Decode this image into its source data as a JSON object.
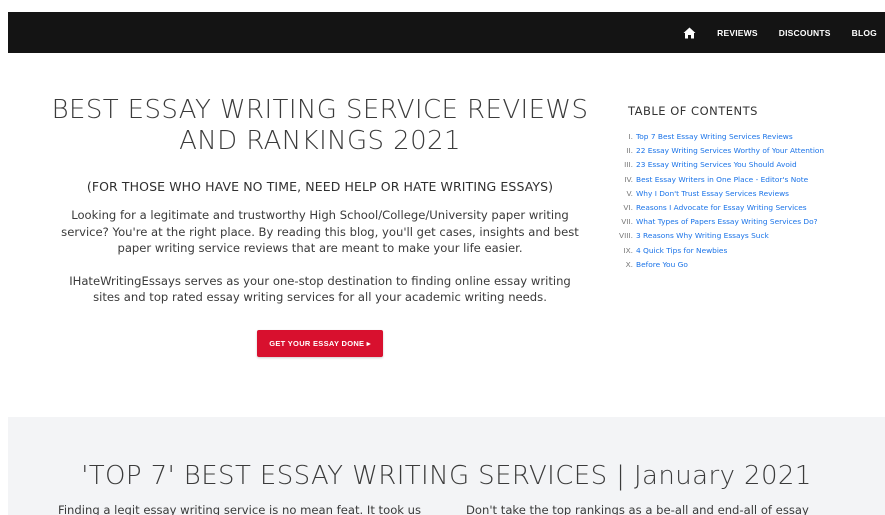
{
  "nav": {
    "home_icon": "home-icon",
    "items": [
      {
        "label": "REVIEWS"
      },
      {
        "label": "DISCOUNTS"
      },
      {
        "label": "BLOG"
      }
    ]
  },
  "hero": {
    "title": "BEST ESSAY WRITING SERVICE REVIEWS AND RANKINGS 2021",
    "subtitle": "(FOR THOSE WHO HAVE NO TIME, NEED HELP OR HATE WRITING ESSAYS)",
    "paragraph1": "Looking for a legitimate and trustworthy High School/College/University paper writing service? You're at the right place. By reading this blog, you'll get cases, insights and best paper writing service reviews that are meant to make your life easier.",
    "paragraph2": "IHateWritingEssays serves as your one-stop destination to finding online essay writing sites and top rated essay writing services for all your academic writing needs.",
    "cta_label": "GET YOUR ESSAY DONE ▸",
    "cta_color": "#d8102e"
  },
  "toc": {
    "title": "TABLE OF CONTENTS",
    "items": [
      {
        "num": "I.",
        "label": "Top 7 Best Essay Writing Services Reviews"
      },
      {
        "num": "II.",
        "label": "22 Essay Writing Services Worthy of Your Attention"
      },
      {
        "num": "III.",
        "label": "23 Essay Writing Services You Should Avoid"
      },
      {
        "num": "IV.",
        "label": "Best Essay Writers in One Place - Editor's Note"
      },
      {
        "num": "V.",
        "label": "Why I Don't Trust Essay Services Reviews"
      },
      {
        "num": "VI.",
        "label": "Reasons I Advocate for Essay Writing Services"
      },
      {
        "num": "VII.",
        "label": "What Types of Papers Essay Writing Services Do?"
      },
      {
        "num": "VIII.",
        "label": "3 Reasons Why Writing Essays Suck"
      },
      {
        "num": "IX.",
        "label": "4 Quick Tips for Newbies"
      },
      {
        "num": "X.",
        "label": "Before You Go"
      }
    ],
    "link_color": "#1a73e8"
  },
  "section2": {
    "title": "'TOP 7' BEST ESSAY WRITING SERVICES | January 2021",
    "left_text": "Finding a legit essay writing service is no mean feat. It took us",
    "right_text": "Don't take the top rankings as a be-all and end-all of essay"
  }
}
